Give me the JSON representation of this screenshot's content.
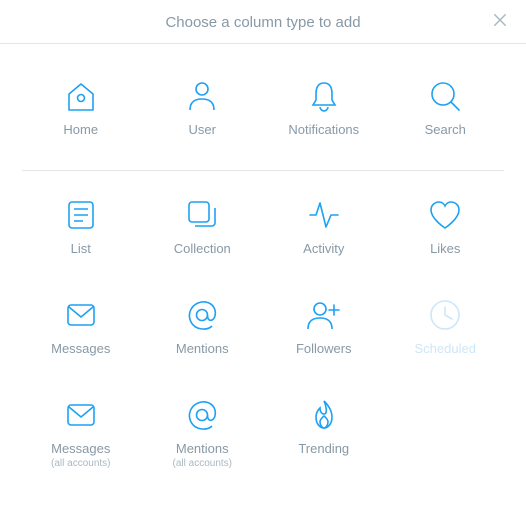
{
  "header": {
    "title": "Choose a column type to add"
  },
  "items": {
    "home": {
      "label": "Home"
    },
    "user": {
      "label": "User"
    },
    "notifications": {
      "label": "Notifications"
    },
    "search": {
      "label": "Search"
    },
    "list": {
      "label": "List"
    },
    "collection": {
      "label": "Collection"
    },
    "activity": {
      "label": "Activity"
    },
    "likes": {
      "label": "Likes"
    },
    "messages": {
      "label": "Messages"
    },
    "mentions": {
      "label": "Mentions"
    },
    "followers": {
      "label": "Followers"
    },
    "scheduled": {
      "label": "Scheduled"
    },
    "messages_all": {
      "label": "Messages",
      "sublabel": "(all accounts)"
    },
    "mentions_all": {
      "label": "Mentions",
      "sublabel": "(all accounts)"
    },
    "trending": {
      "label": "Trending"
    }
  }
}
